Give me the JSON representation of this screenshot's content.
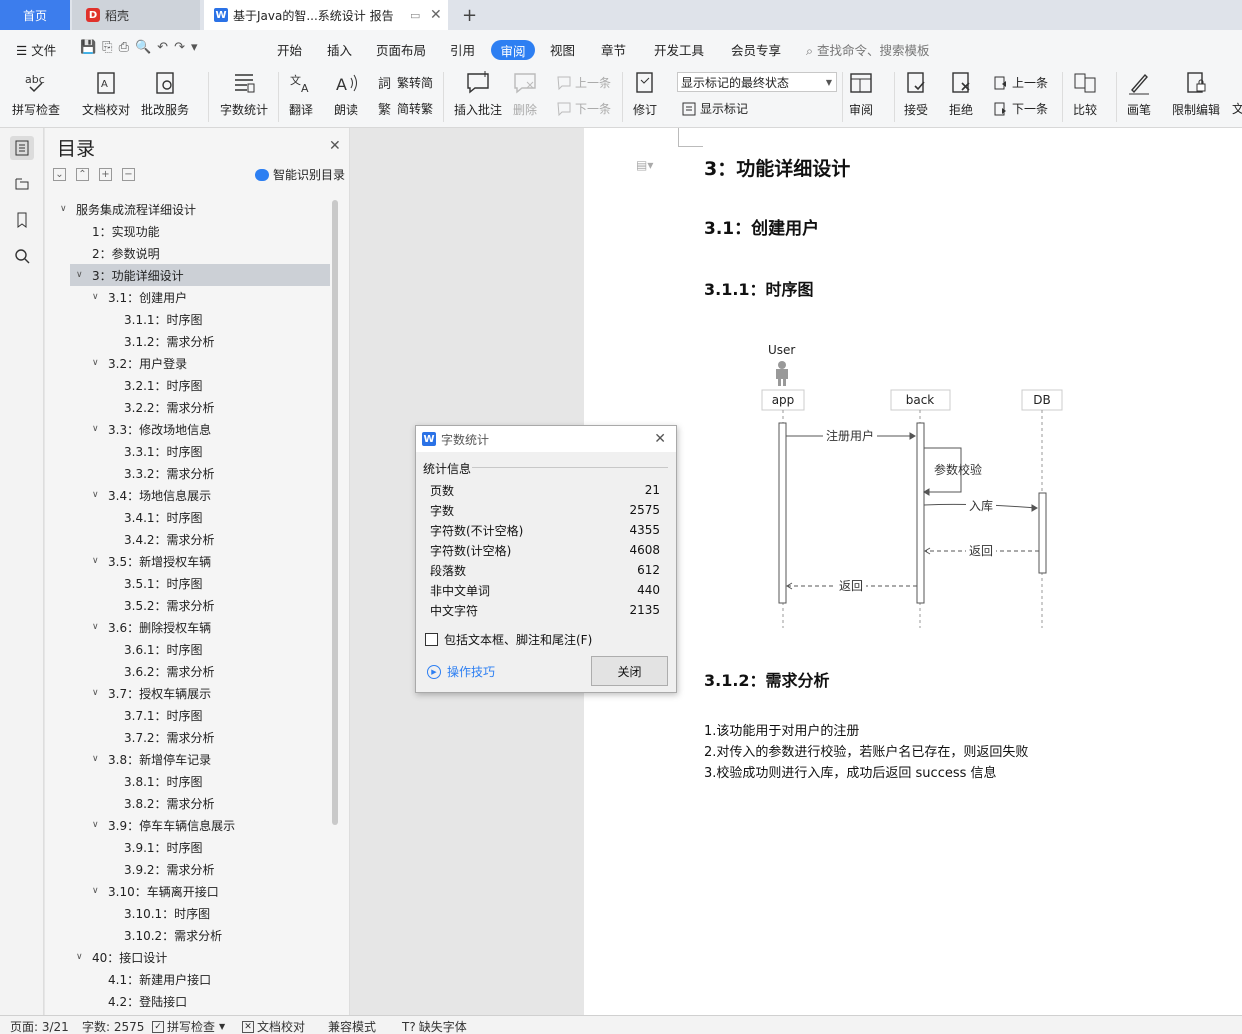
{
  "tabs": {
    "home": "首页",
    "daoke": "稻壳",
    "doc": "基于Java的智...系统设计 报告",
    "new_tab": "+"
  },
  "menu": {
    "file": "文件",
    "items": [
      "开始",
      "插入",
      "页面布局",
      "引用",
      "审阅",
      "视图",
      "章节",
      "开发工具",
      "会员专享"
    ],
    "search": "查找命令、搜索模板"
  },
  "ribbon": {
    "spell": "拼写检查",
    "doc_check": "文档校对",
    "batch": "批改服务",
    "wordcount": "字数统计",
    "translate": "翻译",
    "read": "朗读",
    "trad": "繁转简",
    "simp": "简转繁",
    "insert_comment": "插入批注",
    "delete": "删除",
    "prev": "上一条",
    "next": "下一条",
    "revise": "修订",
    "display_select": "显示标记的最终状态",
    "show_markup": "显示标记",
    "review": "审阅",
    "accept": "接受",
    "reject": "拒绝",
    "prev2": "上一条",
    "next2": "下一条",
    "compare": "比较",
    "pen": "画笔",
    "restrict": "限制编辑",
    "doc_cut": "文"
  },
  "toc": {
    "title": "目录",
    "smart": "智能识别目录",
    "items": [
      {
        "label": "服务集成流程详细设计",
        "level": 0,
        "chev": true
      },
      {
        "label": "1：实现功能",
        "level": 1,
        "chev": false
      },
      {
        "label": "2：参数说明",
        "level": 1,
        "chev": false
      },
      {
        "label": "3：功能详细设计",
        "level": 1,
        "chev": true,
        "selected": true
      },
      {
        "label": "3.1：创建用户",
        "level": 2,
        "chev": true
      },
      {
        "label": "3.1.1：时序图",
        "level": 3,
        "chev": false
      },
      {
        "label": "3.1.2：需求分析",
        "level": 3,
        "chev": false
      },
      {
        "label": "3.2：用户登录",
        "level": 2,
        "chev": true
      },
      {
        "label": "3.2.1：时序图",
        "level": 3,
        "chev": false
      },
      {
        "label": "3.2.2：需求分析",
        "level": 3,
        "chev": false
      },
      {
        "label": "3.3：修改场地信息",
        "level": 2,
        "chev": true
      },
      {
        "label": "3.3.1：时序图",
        "level": 3,
        "chev": false
      },
      {
        "label": "3.3.2：需求分析",
        "level": 3,
        "chev": false
      },
      {
        "label": "3.4：场地信息展示",
        "level": 2,
        "chev": true
      },
      {
        "label": "3.4.1：时序图",
        "level": 3,
        "chev": false
      },
      {
        "label": "3.4.2：需求分析",
        "level": 3,
        "chev": false
      },
      {
        "label": "3.5：新增授权车辆",
        "level": 2,
        "chev": true
      },
      {
        "label": "3.5.1：时序图",
        "level": 3,
        "chev": false
      },
      {
        "label": "3.5.2：需求分析",
        "level": 3,
        "chev": false
      },
      {
        "label": "3.6：删除授权车辆",
        "level": 2,
        "chev": true
      },
      {
        "label": "3.6.1：时序图",
        "level": 3,
        "chev": false
      },
      {
        "label": "3.6.2：需求分析",
        "level": 3,
        "chev": false
      },
      {
        "label": "3.7：授权车辆展示",
        "level": 2,
        "chev": true
      },
      {
        "label": "3.7.1：时序图",
        "level": 3,
        "chev": false
      },
      {
        "label": "3.7.2：需求分析",
        "level": 3,
        "chev": false
      },
      {
        "label": "3.8：新增停车记录",
        "level": 2,
        "chev": true
      },
      {
        "label": "3.8.1：时序图",
        "level": 3,
        "chev": false
      },
      {
        "label": "3.8.2：需求分析",
        "level": 3,
        "chev": false
      },
      {
        "label": "3.9：停车车辆信息展示",
        "level": 2,
        "chev": true
      },
      {
        "label": "3.9.1：时序图",
        "level": 3,
        "chev": false
      },
      {
        "label": "3.9.2：需求分析",
        "level": 3,
        "chev": false
      },
      {
        "label": "3.10：车辆离开接口",
        "level": 2,
        "chev": true
      },
      {
        "label": "3.10.1：时序图",
        "level": 3,
        "chev": false
      },
      {
        "label": "3.10.2：需求分析",
        "level": 3,
        "chev": false
      },
      {
        "label": "40：接口设计",
        "level": 1,
        "chev": true
      },
      {
        "label": "4.1：新建用户接口",
        "level": 2,
        "chev": false
      },
      {
        "label": "4.2：登陆接口",
        "level": 2,
        "chev": false
      }
    ]
  },
  "doc": {
    "h1": "3：功能详细设计",
    "h2": "3.1：创建用户",
    "h3a": "3.1.1：时序图",
    "h3b": "3.1.2：需求分析",
    "paras": [
      "1.该功能用于对用户的注册",
      "2.对传入的参数进行校验，若账户名已存在，则返回失败",
      "3.校验成功则进行入库，成功后返回 success 信息"
    ],
    "diagram": {
      "actor": "User",
      "lanes": [
        "app",
        "back",
        "DB"
      ],
      "messages": [
        "注册用户",
        "参数校验",
        "入库",
        "返回",
        "返回"
      ]
    }
  },
  "dialog": {
    "title": "字数统计",
    "section": "统计信息",
    "rows": [
      {
        "k": "页数",
        "v": "21"
      },
      {
        "k": "字数",
        "v": "2575"
      },
      {
        "k": "字符数(不计空格)",
        "v": "4355"
      },
      {
        "k": "字符数(计空格)",
        "v": "4608"
      },
      {
        "k": "段落数",
        "v": "612"
      },
      {
        "k": "非中文单词",
        "v": "440"
      },
      {
        "k": "中文字符",
        "v": "2135"
      }
    ],
    "checkbox": "包括文本框、脚注和尾注(F)",
    "tips": "操作技巧",
    "close": "关闭"
  },
  "status": {
    "page": "页面: 3/21",
    "words": "字数: 2575",
    "spell": "拼写检查",
    "check": "文档校对",
    "compat": "兼容模式",
    "missing_font": "缺失字体"
  },
  "colors": {
    "accent": "#2d7ff2",
    "tab_home": "#3c7ded"
  }
}
